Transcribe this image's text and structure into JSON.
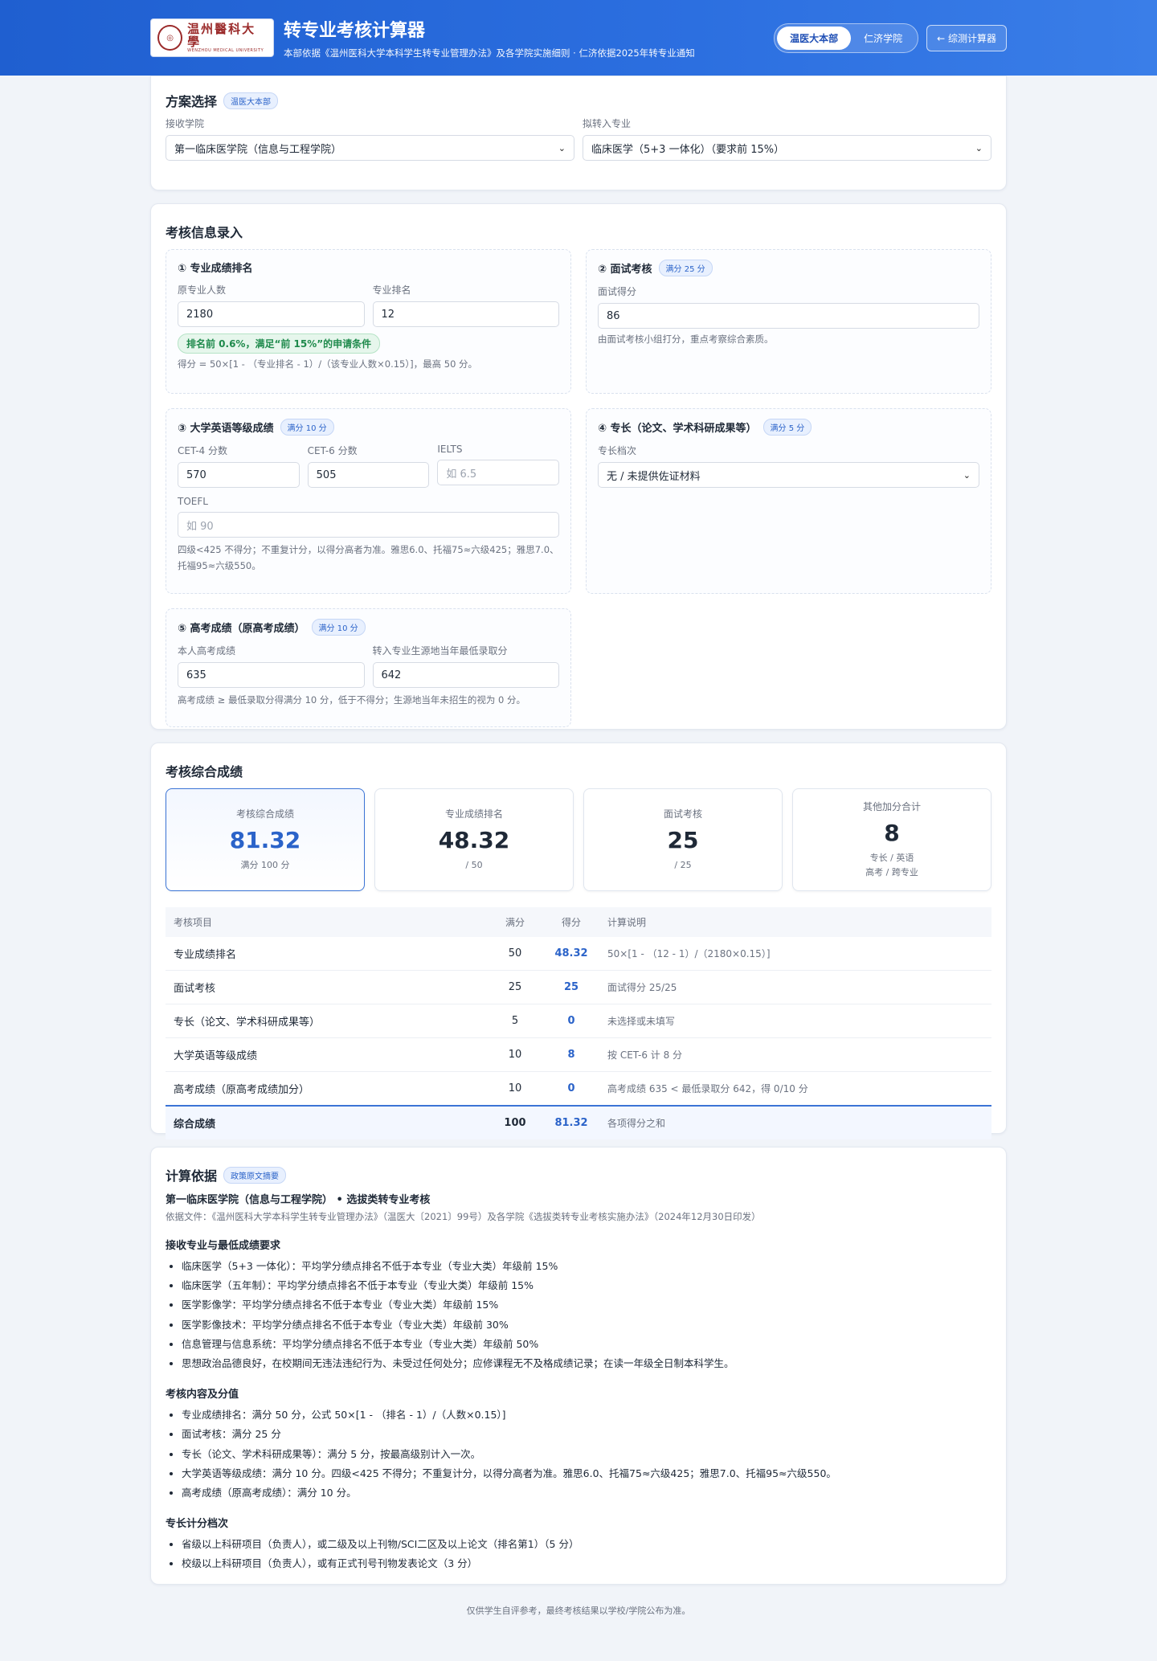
{
  "header": {
    "logo_cn": "温州醫科大學",
    "logo_en": "WENZHOU MEDICAL UNIVERSITY",
    "title": "转专业考核计算器",
    "subtitle": "本部依据《温州医科大学本科学生转专业管理办法》及各学院实施细则 · 仁济依据2025年转专业通知",
    "seg_main": "温医大本部",
    "seg_renji": "仁济学院",
    "back_button": "← 综测计算器"
  },
  "plan": {
    "title": "方案选择",
    "tag": "温医大本部",
    "college_label": "接收学院",
    "college_value": "第一临床医学院（信息与工程学院）",
    "major_label": "拟转入专业",
    "major_value": "临床医学（5+3 一体化）（要求前 15%）"
  },
  "input": {
    "title": "考核信息录入",
    "rank": {
      "title": "① 专业成绩排名",
      "total_label": "原专业人数",
      "total_value": "2180",
      "rank_label": "专业排名",
      "rank_value": "12",
      "ok_text": "排名前 0.6%，满足“前 15%”的申请条件",
      "formula": "得分 = 50×[1 - （专业排名 - 1）/（该专业人数×0.15）]，最高 50 分。"
    },
    "interview": {
      "title": "② 面试考核",
      "tag": "满分 25 分",
      "label": "面试得分",
      "value": "86",
      "hint": "由面试考核小组打分，重点考察综合素质。"
    },
    "english": {
      "title": "③ 大学英语等级成绩",
      "tag": "满分 10 分",
      "cet4_label": "CET-4 分数",
      "cet4_value": "570",
      "cet6_label": "CET-6 分数",
      "cet6_value": "505",
      "ielts_label": "IELTS",
      "ielts_placeholder": "如 6.5",
      "toefl_label": "TOEFL",
      "toefl_placeholder": "如 90",
      "hint": "四级<425 不得分；不重复计分，以得分高者为准。雅思6.0、托福75≈六级425；雅思7.0、托福95≈六级550。"
    },
    "specialty": {
      "title": "④ 专长（论文、学术科研成果等）",
      "tag": "满分 5 分",
      "label": "专长档次",
      "value": "无 / 未提供佐证材料"
    },
    "gaokao": {
      "title": "⑤ 高考成绩（原高考成绩）",
      "tag": "满分 10 分",
      "own_label": "本人高考成绩",
      "own_value": "635",
      "min_label": "转入专业生源地当年最低录取分",
      "min_value": "642",
      "hint": "高考成绩 ≥ 最低录取分得满分 10 分，低于不得分；生源地当年未招生的视为 0 分。"
    }
  },
  "result": {
    "title": "考核综合成绩",
    "stats": [
      {
        "label": "考核综合成绩",
        "value": "81.32",
        "sub": "满分 100 分",
        "sub2": ""
      },
      {
        "label": "专业成绩排名",
        "value": "48.32",
        "sub": "/ 50",
        "sub2": ""
      },
      {
        "label": "面试考核",
        "value": "25",
        "sub": "/ 25",
        "sub2": ""
      },
      {
        "label": "其他加分合计",
        "value": "8",
        "sub": "专长 / 英语",
        "sub2": "高考 / 跨专业"
      }
    ],
    "headers": [
      "考核项目",
      "满分",
      "得分",
      "计算说明"
    ],
    "rows": [
      {
        "item": "专业成绩排名",
        "full": "50",
        "score": "48.32",
        "exp": "50×[1 - （12 - 1）/（2180×0.15）]"
      },
      {
        "item": "面试考核",
        "full": "25",
        "score": "25",
        "exp": "面试得分 25/25"
      },
      {
        "item": "专长（论文、学术科研成果等）",
        "full": "5",
        "score": "0",
        "exp": "未选择或未填写"
      },
      {
        "item": "大学英语等级成绩",
        "full": "10",
        "score": "8",
        "exp": "按 CET-6 计 8 分"
      },
      {
        "item": "高考成绩（原高考成绩加分）",
        "full": "10",
        "score": "0",
        "exp": "高考成绩 635 < 最低录取分 642，得 0/10 分"
      }
    ],
    "total": {
      "item": "综合成绩",
      "full": "100",
      "score": "81.32",
      "exp": "各项得分之和"
    }
  },
  "basis": {
    "title": "计算依据",
    "tag": "政策原文摘要",
    "heading": "第一临床医学院（信息与工程学院） • 选拔类转专业考核",
    "doc": "依据文件：《温州医科大学本科学生转专业管理办法》（温医大〔2021〕99号）及各学院《选拔类转专业考核实施办法》（2024年12月30日印发）",
    "sec1_title": "接收专业与最低成绩要求",
    "sec1": [
      "临床医学（5+3 一体化）：平均学分绩点排名不低于本专业（专业大类）年级前 15%",
      "临床医学（五年制）：平均学分绩点排名不低于本专业（专业大类）年级前 15%",
      "医学影像学：平均学分绩点排名不低于本专业（专业大类）年级前 15%",
      "医学影像技术：平均学分绩点排名不低于本专业（专业大类）年级前 30%",
      "信息管理与信息系统：平均学分绩点排名不低于本专业（专业大类）年级前 50%",
      "思想政治品德良好，在校期间无违法违纪行为、未受过任何处分；应修课程无不及格成绩记录；在读一年级全日制本科学生。"
    ],
    "sec2_title": "考核内容及分值",
    "sec2": [
      "专业成绩排名：满分 50 分，公式 50×[1 - （排名 - 1）/（人数×0.15）]",
      "面试考核：满分 25 分",
      "专长（论文、学术科研成果等）：满分 5 分，按最高级别计入一次。",
      "大学英语等级成绩：满分 10 分。四级<425 不得分；不重复计分，以得分高者为准。雅思6.0、托福75≈六级425；雅思7.0、托福95≈六级550。",
      "高考成绩（原高考成绩）：满分 10 分。"
    ],
    "sec3_title": "专长计分档次",
    "sec3": [
      "省级以上科研项目（负责人），或二级及以上刊物/SCI二区及以上论文（排名第1）（5 分）",
      "校级以上科研项目（负责人），或有正式刊号刊物发表论文（3 分）"
    ]
  },
  "footer": "仅供学生自评参考，最终考核结果以学校/学院公布为准。"
}
